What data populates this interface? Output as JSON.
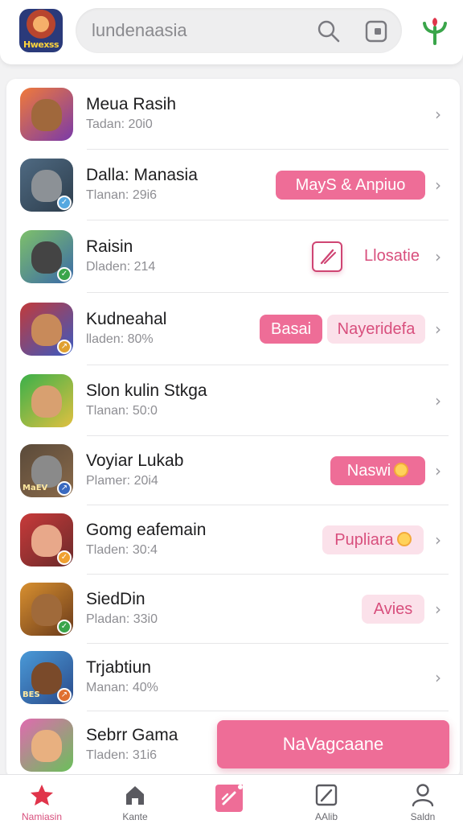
{
  "header": {
    "logo_text": "Hwexss",
    "search_placeholder": "lundenaasia"
  },
  "rows": [
    {
      "title": "Meua Rasih",
      "subtitle": "Tadan: 20i0",
      "avatar_colors": [
        "#f07a3a",
        "#7a3aa8"
      ],
      "face": "#a0683c"
    },
    {
      "title": "Dalla: Manasia",
      "subtitle": "Tlanan: 29i6",
      "avatar_colors": [
        "#4f6a82",
        "#2d3d4c"
      ],
      "face": "#8c9196",
      "badge": "check",
      "badge_color": "#56a8e0",
      "tag": "MayS & Anpiuo",
      "tag_style": "solid"
    },
    {
      "title": "Raisin",
      "subtitle": "Dladen: 214",
      "avatar_colors": [
        "#7ec06a",
        "#3a6aa8"
      ],
      "face": "#444444",
      "badge": "check",
      "badge_color": "#3aa54a",
      "link": "Llosatie",
      "has_edit": true
    },
    {
      "title": "Kudneahal",
      "subtitle": "lladen: 80%",
      "avatar_colors": [
        "#c23a3a",
        "#3a5ac2"
      ],
      "face": "#c88a5a",
      "badge": "arrow",
      "badge_color": "#e0a030",
      "tag": "Basai",
      "tag_style": "solid",
      "tag2": "Nayeridefa",
      "tag2_style": "soft"
    },
    {
      "title": "Slon kulin Stkga",
      "subtitle": "Tlanan: 50:0",
      "avatar_colors": [
        "#3ab04a",
        "#e0c040"
      ],
      "face": "#d8a070"
    },
    {
      "title": "Voyiar Lukab",
      "subtitle": "Plamer: 20i4",
      "avatar_colors": [
        "#5a4a3a",
        "#8a6a4a"
      ],
      "face": "#8a8a8a",
      "badge": "arrow",
      "badge_color": "#3a6ac0",
      "logo_label": "MaEV",
      "tag": "Naswi",
      "tag_style": "solid",
      "tag_icon": true
    },
    {
      "title": "Gomg eafemain",
      "subtitle": "Tladen: 30:4",
      "avatar_colors": [
        "#c83a3a",
        "#6a2a2a"
      ],
      "face": "#e8a88a",
      "badge": "check",
      "badge_color": "#f0a030",
      "tag": "Pupliara",
      "tag_style": "soft",
      "tag_icon": true
    },
    {
      "title": "SiedDin",
      "subtitle": "Pladan: 33i0",
      "avatar_colors": [
        "#d89030",
        "#6a3a1a"
      ],
      "face": "#a06a3a",
      "badge": "check",
      "badge_color": "#3aa54a",
      "tag": "Avies",
      "tag_style": "soft"
    },
    {
      "title": "Trjabtiun",
      "subtitle": "Manan: 40%",
      "avatar_colors": [
        "#4a9ad8",
        "#2a4a8a"
      ],
      "face": "#7a4a2a",
      "badge": "arrow",
      "badge_color": "#e07030",
      "logo_label": "BES"
    },
    {
      "title": "Sebrr Gama",
      "subtitle": "Tladen: 31i6",
      "avatar_colors": [
        "#e06ab0",
        "#6ac05a"
      ],
      "face": "#e8b080"
    }
  ],
  "fab_label": "NaVagcaane",
  "nav": [
    {
      "label": "Namiasin",
      "icon": "star-icon",
      "active": true
    },
    {
      "label": "Kante",
      "icon": "home-icon"
    },
    {
      "label": "",
      "icon": "edit-icon"
    },
    {
      "label": "AAlib",
      "icon": "note-icon"
    },
    {
      "label": "Saldn",
      "icon": "user-icon"
    }
  ],
  "colors": {
    "accent": "#ee6d97",
    "accent_soft": "#fbe1ea",
    "accent_text": "#d84f7d"
  }
}
